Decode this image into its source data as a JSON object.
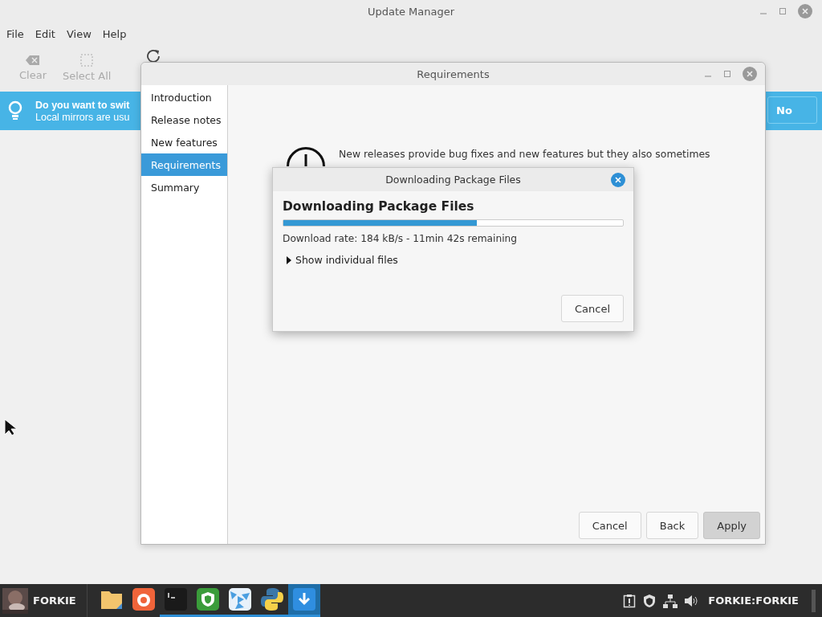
{
  "main_window": {
    "title": "Update Manager",
    "menu": [
      "File",
      "Edit",
      "View",
      "Help"
    ],
    "toolbar": [
      {
        "label": "Clear",
        "kind": "clear",
        "disabled": true
      },
      {
        "label": "Select All",
        "kind": "select",
        "disabled": true
      }
    ],
    "infobar": {
      "title": "Do you want to swit",
      "text": "Local mirrors are usu",
      "button": "No"
    }
  },
  "requirements_window": {
    "title": "Requirements",
    "steps": [
      {
        "label": "Introduction",
        "selected": false
      },
      {
        "label": "Release notes",
        "selected": false
      },
      {
        "label": "New features",
        "selected": false
      },
      {
        "label": "Requirements",
        "selected": true
      },
      {
        "label": "Summary",
        "selected": false
      }
    ],
    "message": [
      "New releases provide bug fixes and new features but they also sometimes"
    ],
    "buttons": [
      {
        "label": "Cancel",
        "default": false
      },
      {
        "label": "Back",
        "default": false
      },
      {
        "label": "Apply",
        "default": true
      }
    ]
  },
  "progress_dialog": {
    "title": "Downloading Package Files",
    "heading": "Downloading Package Files",
    "level": 0.57,
    "status": "Download rate: 184 kB/s - 11min 42s remaining",
    "expander": {
      "label": "Show individual files",
      "expanded": false
    },
    "button": "Cancel"
  },
  "taskbar": {
    "user": "FORKIE",
    "apps": [
      {
        "kind": "folder",
        "running": false,
        "active": false
      },
      {
        "kind": "firefox",
        "running": false,
        "active": false
      },
      {
        "kind": "terminal",
        "running": true,
        "active": false
      },
      {
        "kind": "shield",
        "running": true,
        "active": false
      },
      {
        "kind": "video",
        "running": true,
        "active": false
      },
      {
        "kind": "python",
        "running": true,
        "active": false
      },
      {
        "kind": "download",
        "running": true,
        "active": true
      }
    ],
    "session": "FORKIE:FORKIE"
  }
}
